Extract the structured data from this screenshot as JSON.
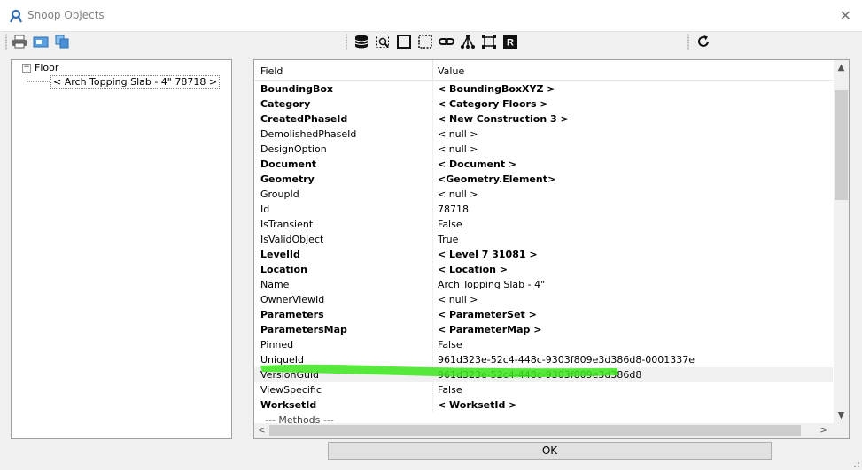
{
  "window": {
    "title": "Snoop Objects",
    "close_glyph": "✕"
  },
  "toolbar": {
    "left_icons": [
      "printer-icon",
      "preview-icon",
      "copy-icon"
    ],
    "mid_icons": [
      "database-icon",
      "select-query-icon",
      "square-icon",
      "dashed-select-icon",
      "link-icon",
      "hierarchy-icon",
      "dependents-icon",
      "revit-r-icon"
    ],
    "right_icons": [
      "refresh-icon"
    ],
    "revit_letter": "R"
  },
  "tree": {
    "root": {
      "expander": "−",
      "label": "Floor"
    },
    "child": {
      "label": "< Arch Topping Slab - 4\"  78718 >"
    }
  },
  "grid": {
    "headers": {
      "field": "Field",
      "value": "Value"
    },
    "rows": [
      {
        "field": "BoundingBox",
        "value": "< BoundingBoxXYZ >",
        "bold": true
      },
      {
        "field": "Category",
        "value": "< Category  Floors >",
        "bold": true
      },
      {
        "field": "CreatedPhaseId",
        "value": "< New Construction  3 >",
        "bold": true
      },
      {
        "field": "DemolishedPhaseId",
        "value": "< null >",
        "bold": false
      },
      {
        "field": "DesignOption",
        "value": "< null >",
        "bold": false
      },
      {
        "field": "Document",
        "value": "< Document >",
        "bold": true
      },
      {
        "field": "Geometry",
        "value": "<Geometry.Element>",
        "bold": true
      },
      {
        "field": "GroupId",
        "value": "< null >",
        "bold": false
      },
      {
        "field": "Id",
        "value": "78718",
        "bold": false
      },
      {
        "field": "IsTransient",
        "value": "False",
        "bold": false
      },
      {
        "field": "IsValidObject",
        "value": "True",
        "bold": false
      },
      {
        "field": "LevelId",
        "value": "< Level 7  31081 >",
        "bold": true
      },
      {
        "field": "Location",
        "value": "< Location >",
        "bold": true
      },
      {
        "field": "Name",
        "value": "Arch Topping Slab - 4\"",
        "bold": false
      },
      {
        "field": "OwnerViewId",
        "value": "< null >",
        "bold": false
      },
      {
        "field": "Parameters",
        "value": "< ParameterSet >",
        "bold": true
      },
      {
        "field": "ParametersMap",
        "value": "< ParameterMap >",
        "bold": true
      },
      {
        "field": "Pinned",
        "value": "False",
        "bold": false
      },
      {
        "field": "UniqueId",
        "value": "961d323e-52c4-448c-9303f809e3d386d8-0001337e",
        "bold": false
      },
      {
        "field": "VersionGuid",
        "value": "961d323e-52c4-448c-9303f809e3d386d8",
        "bold": false,
        "selected": true
      },
      {
        "field": "ViewSpecific",
        "value": "False",
        "bold": false
      },
      {
        "field": "WorksetId",
        "value": "< WorksetId >",
        "bold": true
      }
    ],
    "methods_label": "--- Methods ---",
    "scroll_arrows": {
      "up": "▲",
      "down": "▼",
      "left": "<",
      "right": ">"
    }
  },
  "ok_button": {
    "label": "OK"
  },
  "colors": {
    "highlight": "#3ce61c",
    "title_icon": "#2d6db5"
  }
}
